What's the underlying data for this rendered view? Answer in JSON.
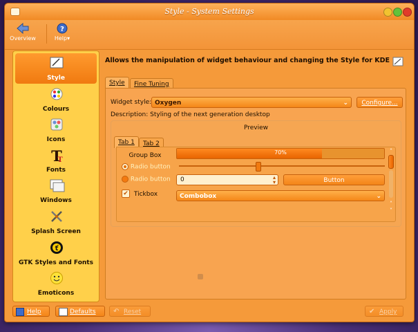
{
  "window": {
    "title": "Style - System Settings"
  },
  "toolbar": {
    "overview_label": "Overview",
    "help_label": "Help"
  },
  "sidebar": {
    "items": [
      {
        "label": "Style",
        "icon": "style-icon",
        "selected": true
      },
      {
        "label": "Colours",
        "icon": "colours-icon"
      },
      {
        "label": "Icons",
        "icon": "icons-icon"
      },
      {
        "label": "Fonts",
        "icon": "fonts-icon"
      },
      {
        "label": "Windows",
        "icon": "windows-icon"
      },
      {
        "label": "Splash Screen",
        "icon": "splash-screen-icon"
      },
      {
        "label": "GTK Styles and Fonts",
        "icon": "gtk-icon"
      },
      {
        "label": "Emoticons",
        "icon": "emoticons-icon"
      }
    ]
  },
  "main": {
    "heading": "Allows the manipulation of widget behaviour and changing the Style for KDE",
    "tabs": [
      {
        "label": "Style"
      },
      {
        "label": "Fine Tuning"
      }
    ],
    "widget_style_label": "Widget style:",
    "widget_style_value": "Oxygen",
    "configure_label": "Configure...",
    "description": "Description: Styling of the next generation desktop",
    "preview": {
      "title": "Preview",
      "tabs": [
        {
          "label": "Tab 1"
        },
        {
          "label": "Tab 2"
        }
      ],
      "group_box_label": "Group Box",
      "radio1_label": "Radio button",
      "radio2_label": "Radio button",
      "tickbox_label": "Tickbox",
      "progress_text": "70%",
      "progress_value": 0.7,
      "slider_value": 0.38,
      "spin_value": "0",
      "button_label": "Button",
      "combobox_label": "Combobox"
    }
  },
  "bottom": {
    "help_label": "Help",
    "defaults_label": "Defaults",
    "reset_label": "Reset",
    "apply_label": "Apply"
  },
  "colors": {
    "accent": "#f59a3a",
    "sidebar": "#ffd04a",
    "progress_fill": "#f07a10"
  }
}
